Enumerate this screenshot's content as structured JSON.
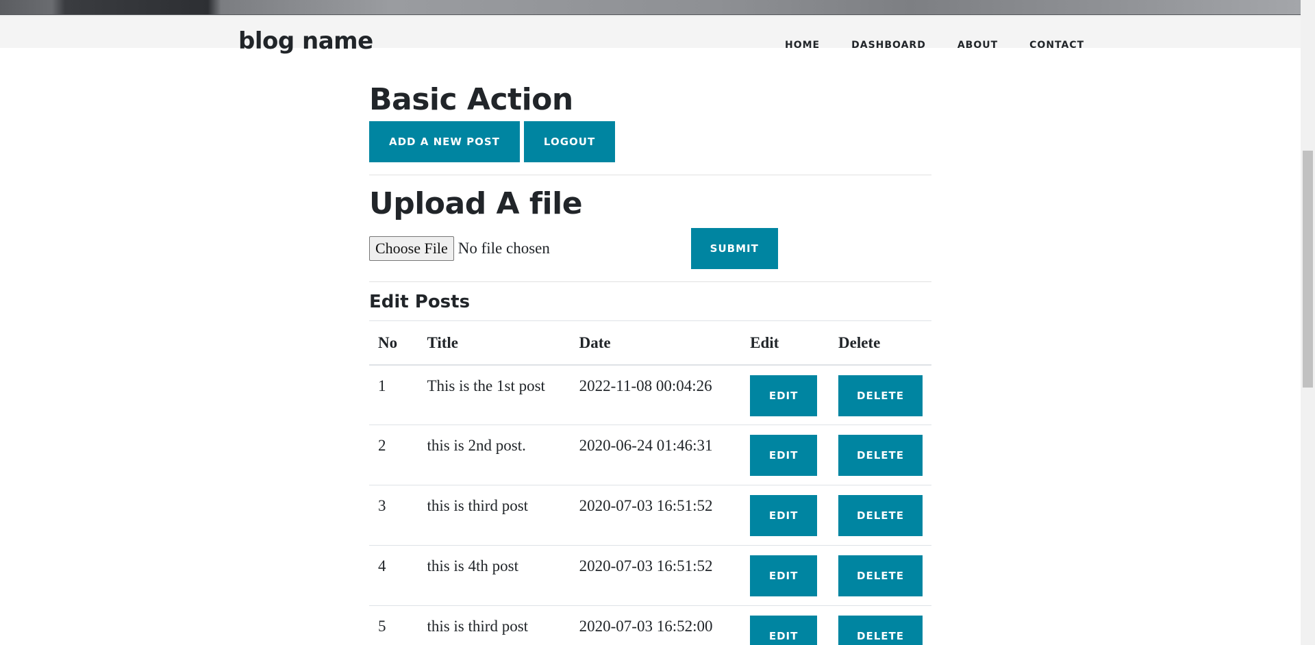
{
  "header": {
    "brand": "blog name",
    "nav": [
      "HOME",
      "DASHBOARD",
      "ABOUT",
      "CONTACT"
    ]
  },
  "basic_action": {
    "title": "Basic Action",
    "add_post_label": "ADD A NEW POST",
    "logout_label": "LOGOUT"
  },
  "upload": {
    "title": "Upload A file",
    "choose_file_label": "Choose File",
    "file_status": "No file chosen",
    "submit_label": "SUBMIT"
  },
  "posts": {
    "title": "Edit Posts",
    "columns": [
      "No",
      "Title",
      "Date",
      "Edit",
      "Delete"
    ],
    "edit_label": "EDIT",
    "delete_label": "DELETE",
    "rows": [
      {
        "no": "1",
        "title": "This is the 1st post",
        "date": "2022-11-08 00:04:26"
      },
      {
        "no": "2",
        "title": "this is 2nd post.",
        "date": "2020-06-24 01:46:31"
      },
      {
        "no": "3",
        "title": "this is third post",
        "date": "2020-07-03 16:51:52"
      },
      {
        "no": "4",
        "title": "this is 4th post",
        "date": "2020-07-03 16:51:52"
      },
      {
        "no": "5",
        "title": "this is third post",
        "date": "2020-07-03 16:52:00"
      }
    ]
  },
  "colors": {
    "accent": "#0085a1",
    "text": "#212529"
  }
}
